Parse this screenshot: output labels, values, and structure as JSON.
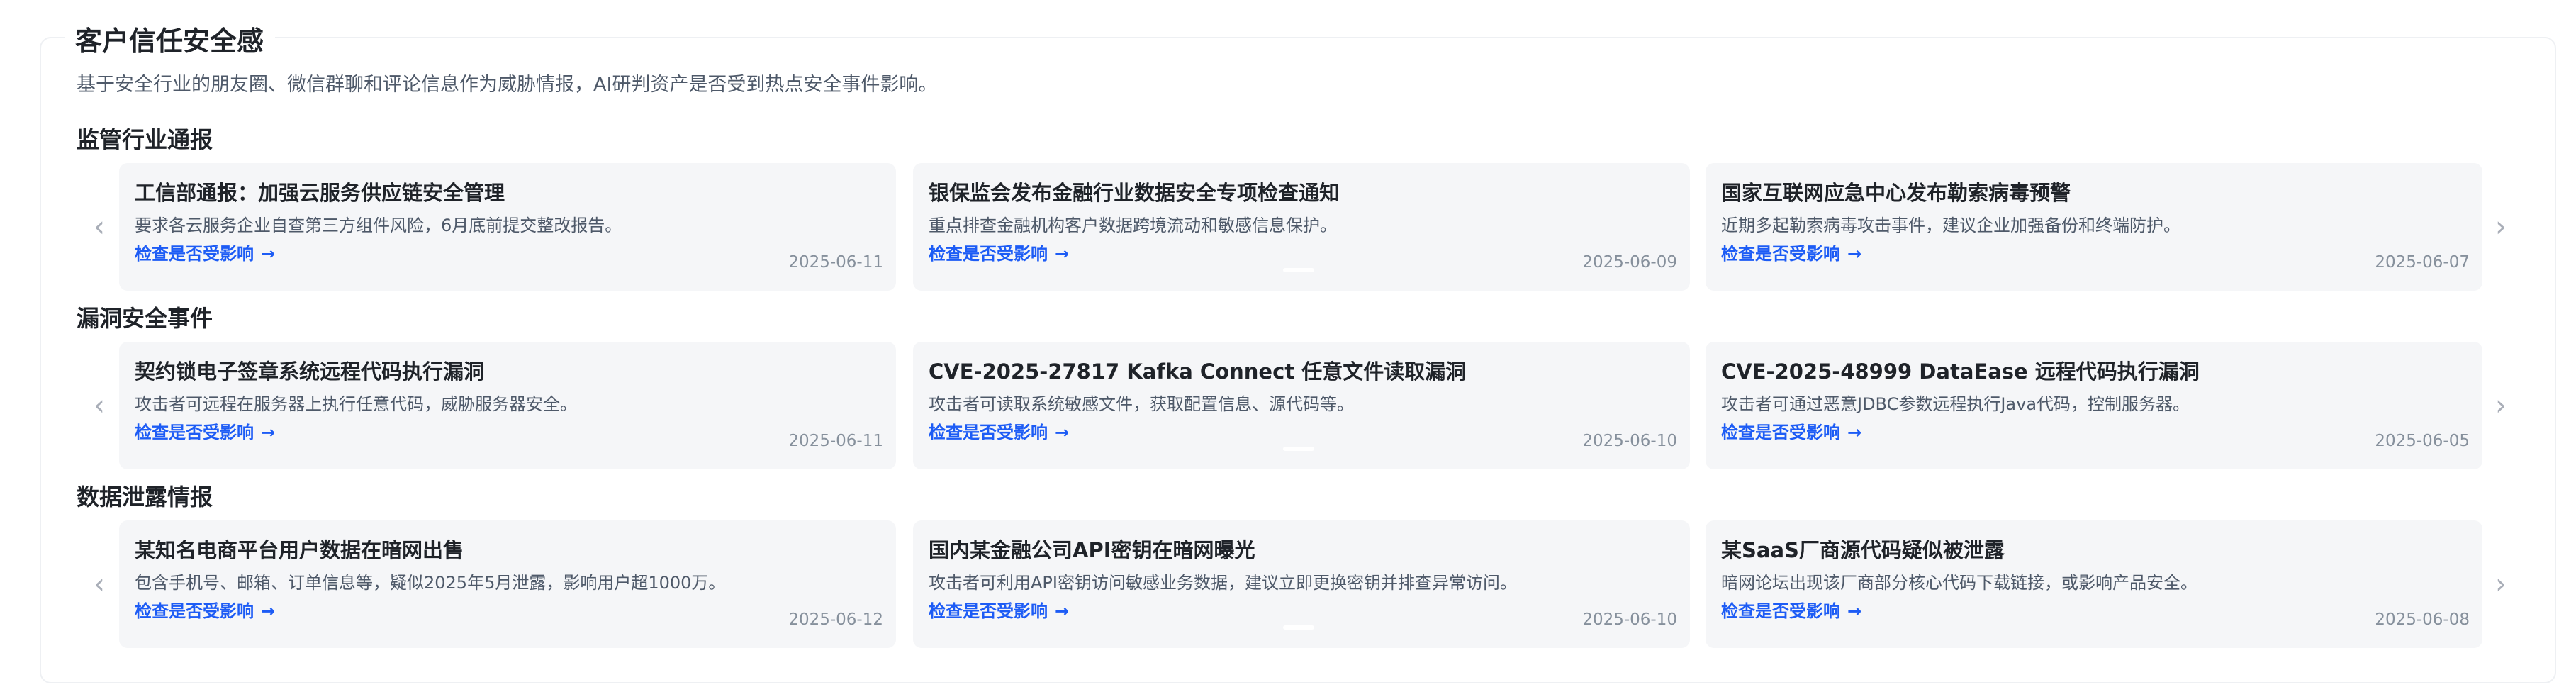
{
  "panel": {
    "title": "客户信任安全感",
    "description": "基于安全行业的朋友圈、微信群聊和评论信息作为威胁情报，AI研判资产是否受到热点安全事件影响。"
  },
  "nav": {
    "prev_icon": "‹",
    "next_icon": "›",
    "link_arrow": "→"
  },
  "sections": [
    {
      "title": "监管行业通报",
      "cards": [
        {
          "title": "工信部通报：加强云服务供应链安全管理",
          "desc": "要求各云服务企业自查第三方组件风险，6月底前提交整改报告。",
          "link": "检查是否受影响",
          "date": "2025-06-11"
        },
        {
          "title": "银保监会发布金融行业数据安全专项检查通知",
          "desc": "重点排查金融机构客户数据跨境流动和敏感信息保护。",
          "link": "检查是否受影响",
          "date": "2025-06-09"
        },
        {
          "title": "国家互联网应急中心发布勒索病毒预警",
          "desc": "近期多起勒索病毒攻击事件，建议企业加强备份和终端防护。",
          "link": "检查是否受影响",
          "date": "2025-06-07"
        }
      ]
    },
    {
      "title": "漏洞安全事件",
      "cards": [
        {
          "title": "契约锁电子签章系统远程代码执行漏洞",
          "desc": "攻击者可远程在服务器上执行任意代码，威胁服务器安全。",
          "link": "检查是否受影响",
          "date": "2025-06-11"
        },
        {
          "title": "CVE-2025-27817 Kafka Connect 任意文件读取漏洞",
          "desc": "攻击者可读取系统敏感文件，获取配置信息、源代码等。",
          "link": "检查是否受影响",
          "date": "2025-06-10"
        },
        {
          "title": "CVE-2025-48999 DataEase 远程代码执行漏洞",
          "desc": "攻击者可通过恶意JDBC参数远程执行Java代码，控制服务器。",
          "link": "检查是否受影响",
          "date": "2025-06-05"
        }
      ]
    },
    {
      "title": "数据泄露情报",
      "cards": [
        {
          "title": "某知名电商平台用户数据在暗网出售",
          "desc": "包含手机号、邮箱、订单信息等，疑似2025年5月泄露，影响用户超1000万。",
          "link": "检查是否受影响",
          "date": "2025-06-12"
        },
        {
          "title": "国内某金融公司API密钥在暗网曝光",
          "desc": "攻击者可利用API密钥访问敏感业务数据，建议立即更换密钥并排查异常访问。",
          "link": "检查是否受影响",
          "date": "2025-06-10"
        },
        {
          "title": "某SaaS厂商源代码疑似被泄露",
          "desc": "暗网论坛出现该厂商部分核心代码下载链接，或影响产品安全。",
          "link": "检查是否受影响",
          "date": "2025-06-08"
        }
      ]
    }
  ]
}
